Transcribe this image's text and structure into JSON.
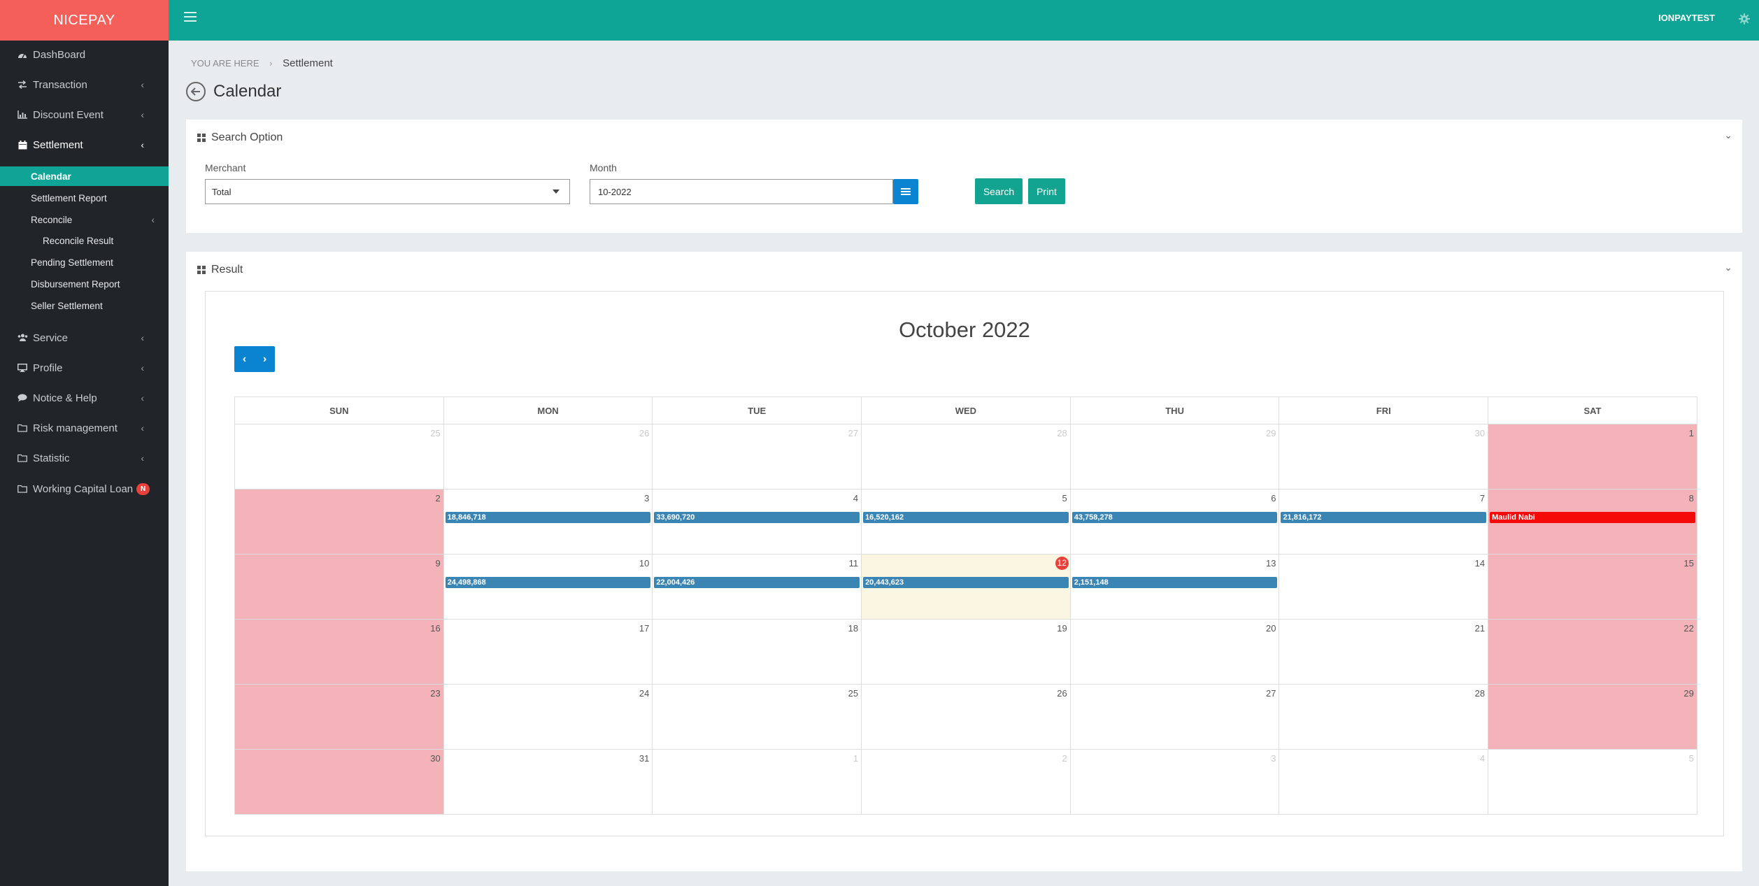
{
  "brand": "NICEPAY",
  "topbar": {
    "username": "IONPAYTEST"
  },
  "sidebar": {
    "items": [
      {
        "label": "DashBoard",
        "icon": "dashboard-icon"
      },
      {
        "label": "Transaction",
        "icon": "exchange-icon"
      },
      {
        "label": "Discount Event",
        "icon": "bar-chart-icon"
      },
      {
        "label": "Settlement",
        "icon": "calendar-icon"
      },
      {
        "label": "Service",
        "icon": "users-icon"
      },
      {
        "label": "Profile",
        "icon": "desktop-icon"
      },
      {
        "label": "Notice & Help",
        "icon": "comment-icon"
      },
      {
        "label": "Risk management",
        "icon": "folder-icon"
      },
      {
        "label": "Statistic",
        "icon": "folder-icon"
      },
      {
        "label": "Working Capital Loan",
        "icon": "folder-icon",
        "badge": "N"
      }
    ],
    "settlement_sub": [
      {
        "label": "Calendar",
        "active": true
      },
      {
        "label": "Settlement Report"
      },
      {
        "label": "Reconcile"
      },
      {
        "label": "Reconcile Result"
      },
      {
        "label": "Pending Settlement"
      },
      {
        "label": "Disbursement Report"
      },
      {
        "label": "Seller Settlement"
      }
    ]
  },
  "breadcrumb": {
    "prefix": "YOU ARE HERE",
    "current": "Settlement"
  },
  "page": {
    "title": "Calendar"
  },
  "search": {
    "title": "Search Option",
    "merchant_label": "Merchant",
    "merchant_value": "Total",
    "month_label": "Month",
    "month_value": "10-2022",
    "search_label": "Search",
    "print_label": "Print"
  },
  "result": {
    "title": "Result",
    "calendar_title": "October 2022",
    "weekdays": [
      "SUN",
      "MON",
      "TUE",
      "WED",
      "THU",
      "FRI",
      "SAT"
    ],
    "weeks": [
      [
        {
          "d": "25",
          "other": true
        },
        {
          "d": "26",
          "other": true
        },
        {
          "d": "27",
          "other": true
        },
        {
          "d": "28",
          "other": true
        },
        {
          "d": "29",
          "other": true
        },
        {
          "d": "30",
          "other": true
        },
        {
          "d": "1",
          "weekend": true
        }
      ],
      [
        {
          "d": "2",
          "weekend": true
        },
        {
          "d": "3",
          "event": "18,846,718"
        },
        {
          "d": "4",
          "event": "33,690,720"
        },
        {
          "d": "5",
          "event": "16,520,162"
        },
        {
          "d": "6",
          "event": "43,758,278"
        },
        {
          "d": "7",
          "event": "21,816,172"
        },
        {
          "d": "8",
          "weekend": true,
          "event": "Maulid Nabi",
          "event_color": "red"
        }
      ],
      [
        {
          "d": "9",
          "weekend": true
        },
        {
          "d": "10",
          "event": "24,498,868"
        },
        {
          "d": "11",
          "event": "22,004,426"
        },
        {
          "d": "12",
          "today": true,
          "event": "20,443,623"
        },
        {
          "d": "13",
          "event": "2,151,148"
        },
        {
          "d": "14"
        },
        {
          "d": "15",
          "weekend": true
        }
      ],
      [
        {
          "d": "16",
          "weekend": true
        },
        {
          "d": "17"
        },
        {
          "d": "18"
        },
        {
          "d": "19"
        },
        {
          "d": "20"
        },
        {
          "d": "21"
        },
        {
          "d": "22",
          "weekend": true
        }
      ],
      [
        {
          "d": "23",
          "weekend": true
        },
        {
          "d": "24"
        },
        {
          "d": "25"
        },
        {
          "d": "26"
        },
        {
          "d": "27"
        },
        {
          "d": "28"
        },
        {
          "d": "29",
          "weekend": true
        }
      ],
      [
        {
          "d": "30",
          "weekend": true
        },
        {
          "d": "31"
        },
        {
          "d": "1",
          "other": true
        },
        {
          "d": "2",
          "other": true
        },
        {
          "d": "3",
          "other": true
        },
        {
          "d": "4",
          "other": true
        },
        {
          "d": "5",
          "other": true
        }
      ]
    ]
  },
  "colors": {
    "brand": "#f55f5a",
    "topbar": "#0ea596",
    "accent": "#0a84d0",
    "weekend": "#f3b3b8",
    "event": "#3a85b4",
    "holiday": "#f50a0a"
  }
}
